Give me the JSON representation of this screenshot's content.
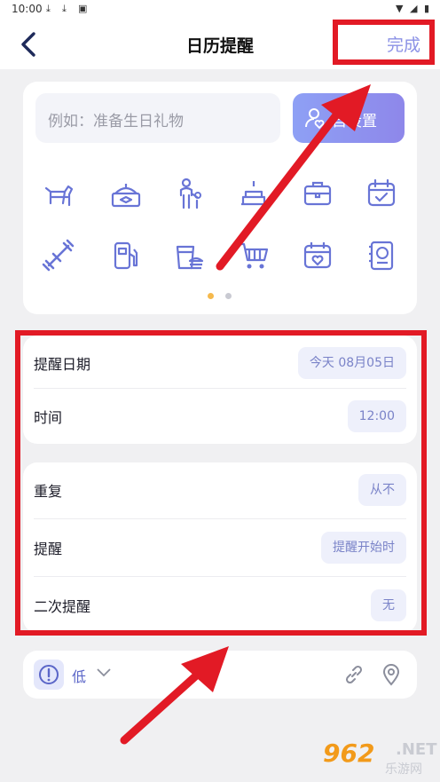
{
  "status_bar": {
    "time": "10:00"
  },
  "header": {
    "title": "日历提醒",
    "done_label": "完成"
  },
  "input": {
    "placeholder": "例如：准备生日礼物"
  },
  "custom_button": {
    "label": "自设置"
  },
  "icons_row1": [
    "dog-icon",
    "gift-box-icon",
    "family-icon",
    "cake-icon",
    "briefcase-icon",
    "calendar-check-icon"
  ],
  "icons_row2": [
    "dumbbell-icon",
    "gas-pump-icon",
    "fast-food-icon",
    "shopping-cart-icon",
    "calendar-heart-icon",
    "money-book-icon"
  ],
  "pager": {
    "current": 1,
    "total": 2
  },
  "dates": [
    {
      "label": "提醒日期",
      "value": "今天 08月05日"
    },
    {
      "label": "时间",
      "value": "12:00"
    }
  ],
  "repeat": [
    {
      "label": "重复",
      "value": "从不"
    },
    {
      "label": "提醒",
      "value": "提醒开始时"
    },
    {
      "label": "二次提醒",
      "value": "无"
    }
  ],
  "priority": {
    "label": "低"
  },
  "watermark": {
    "number": "962",
    "suffix": ".NET",
    "site": "乐游网"
  },
  "colors": {
    "accent": "#8b91e6",
    "highlight": "#e21a25",
    "page_bg": "#f0f0f2",
    "pill_bg": "#eef0fb"
  }
}
